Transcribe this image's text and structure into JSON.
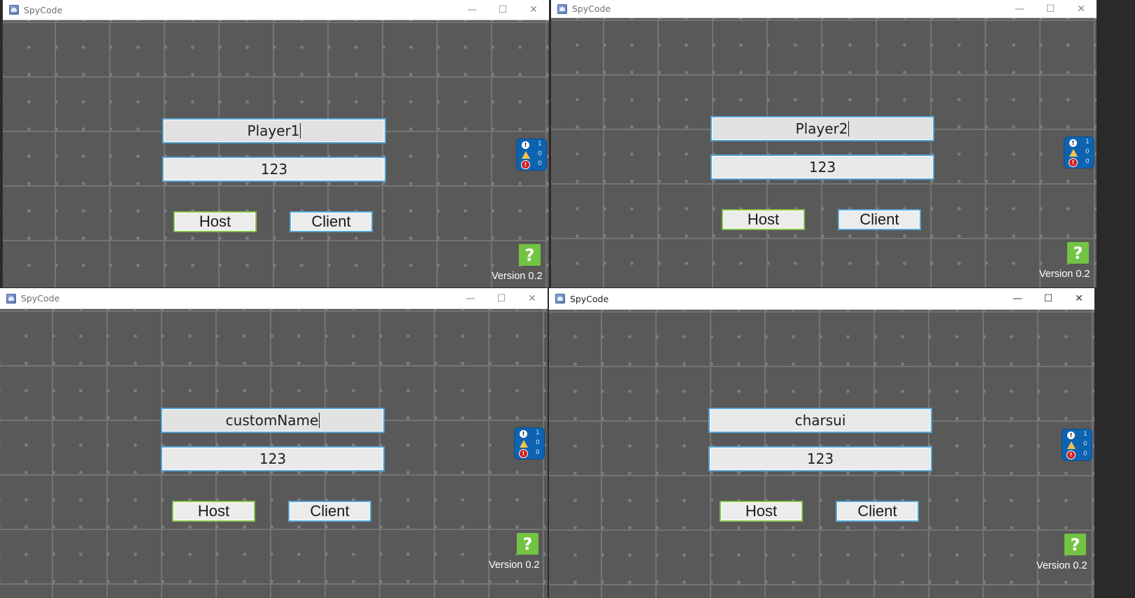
{
  "windows": [
    {
      "title": "SpyCode",
      "name_value": "Player1",
      "password_value": "123",
      "host_label": "Host",
      "client_label": "Client",
      "help_label": "?",
      "version": "Version 0.2",
      "badge": {
        "info": "1",
        "warn": "0",
        "error": "0"
      }
    },
    {
      "title": "SpyCode",
      "name_value": "Player2",
      "password_value": "123",
      "host_label": "Host",
      "client_label": "Client",
      "help_label": "?",
      "version": "Version 0.2",
      "badge": {
        "info": "1",
        "warn": "0",
        "error": "0"
      }
    },
    {
      "title": "SpyCode",
      "name_value": "customName",
      "password_value": "123",
      "host_label": "Host",
      "client_label": "Client",
      "help_label": "?",
      "version": "Version 0.2",
      "badge": {
        "info": "1",
        "warn": "0",
        "error": "0"
      }
    },
    {
      "title": "SpyCode",
      "name_value": "charsui",
      "password_value": "123",
      "host_label": "Host",
      "client_label": "Client",
      "help_label": "?",
      "version": "Version 0.2",
      "badge": {
        "info": "1",
        "warn": "0",
        "error": "0"
      }
    }
  ],
  "window_controls": {
    "minimize": "—",
    "maximize": "☐",
    "close": "✕"
  },
  "colors": {
    "background": "#595959",
    "grid": "#747474",
    "field_border": "#58a8d8",
    "host_border": "#86c24a",
    "help": "#73c442",
    "badge": "#0d63b0"
  }
}
